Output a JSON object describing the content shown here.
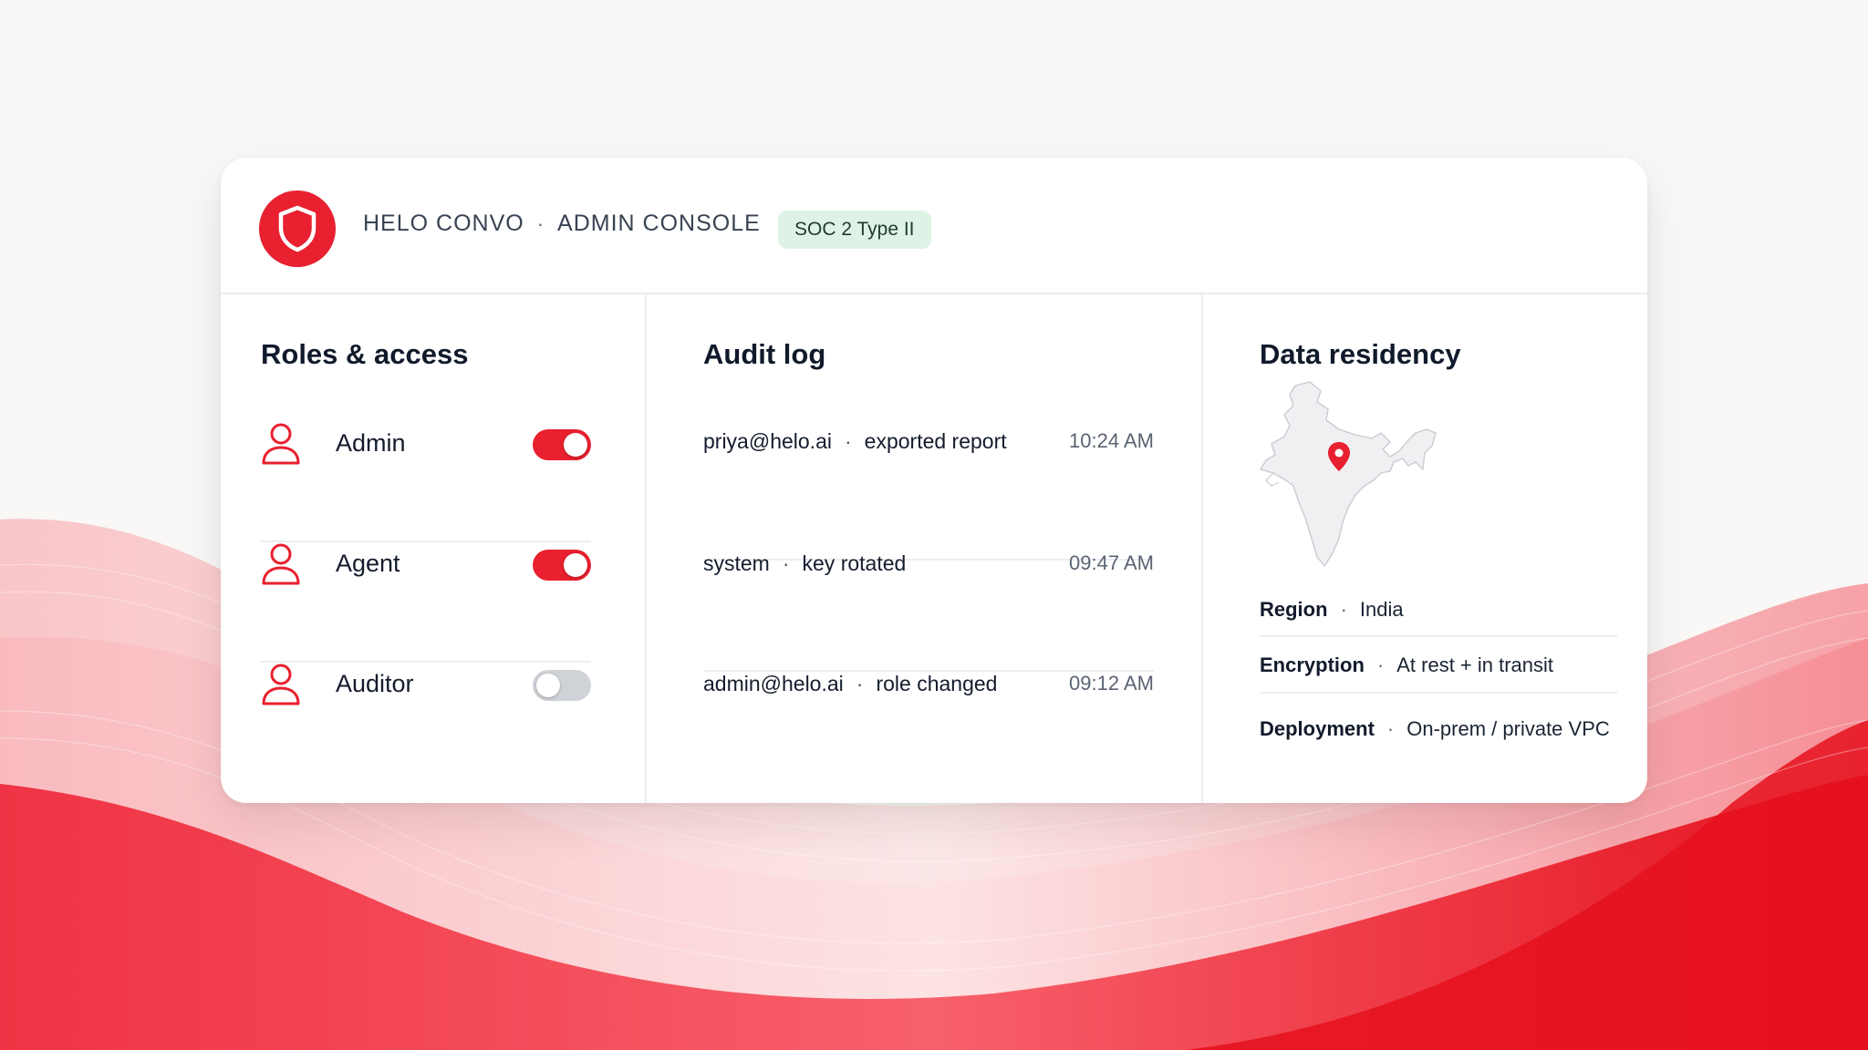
{
  "header": {
    "brand": "HELO CONVO",
    "brand_sep": "·",
    "console": "ADMIN CONSOLE",
    "badge": "SOC 2 Type II"
  },
  "roles": {
    "title": "Roles & access",
    "items": [
      {
        "label": "Admin",
        "enabled": true
      },
      {
        "label": "Agent",
        "enabled": true
      },
      {
        "label": "Auditor",
        "enabled": false
      }
    ]
  },
  "audit": {
    "title": "Audit log",
    "entries": [
      {
        "actor": "priya@helo.ai",
        "sep": "·",
        "action": "exported report",
        "time": "10:24 AM"
      },
      {
        "actor": "system",
        "sep": "·",
        "action": "key rotated",
        "time": "09:47 AM"
      },
      {
        "actor": "admin@helo.ai",
        "sep": "·",
        "action": "role changed",
        "time": "09:12 AM"
      }
    ]
  },
  "residency": {
    "title": "Data residency",
    "rows": [
      {
        "key": "Region",
        "sep": "·",
        "value": "India"
      },
      {
        "key": "Encryption",
        "sep": "·",
        "value": "At rest + in transit"
      },
      {
        "key": "Deployment",
        "sep": "·",
        "value": "On-prem / private VPC"
      }
    ]
  },
  "colors": {
    "accent": "#e8202f",
    "badge_bg": "#def3e6",
    "toggle_off": "#cfd2d7"
  },
  "icons": {
    "logo": "shield-icon",
    "role": "person-icon",
    "map_pin": "map-pin-icon"
  }
}
